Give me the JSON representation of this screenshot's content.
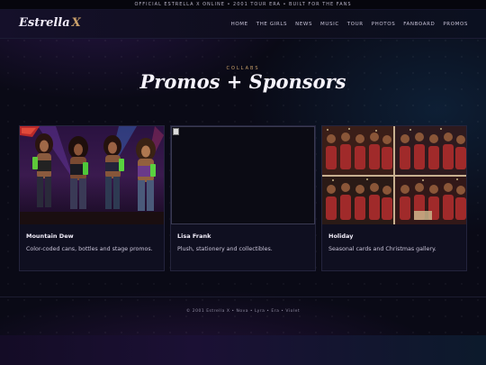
{
  "topbar": {
    "text": "OFFICIAL ESTRELLA X ONLINE • 2001 TOUR ERA • BUILT FOR THE FANS"
  },
  "brand": {
    "name": "Estrella",
    "mark": "X",
    "accent": "#c9a06a"
  },
  "nav": {
    "items": [
      "HOME",
      "THE GIRLS",
      "NEWS",
      "MUSIC",
      "TOUR",
      "PHOTOS",
      "FANBOARD",
      "PROMOS"
    ]
  },
  "page": {
    "eyebrow": "COLLABS",
    "title": "Promos + Sponsors"
  },
  "cards": [
    {
      "name": "Mountain Dew",
      "desc": "Color-coded cans, bottles and stage promos."
    },
    {
      "name": "Lisa Frank",
      "desc": "Plush, stationery and collectibles."
    },
    {
      "name": "Holiday",
      "desc": "Seasonal cards and Christmas gallery."
    }
  ],
  "footer": {
    "text": "© 2001 Estrella X • Nova • Lyra • Era • Violet"
  }
}
